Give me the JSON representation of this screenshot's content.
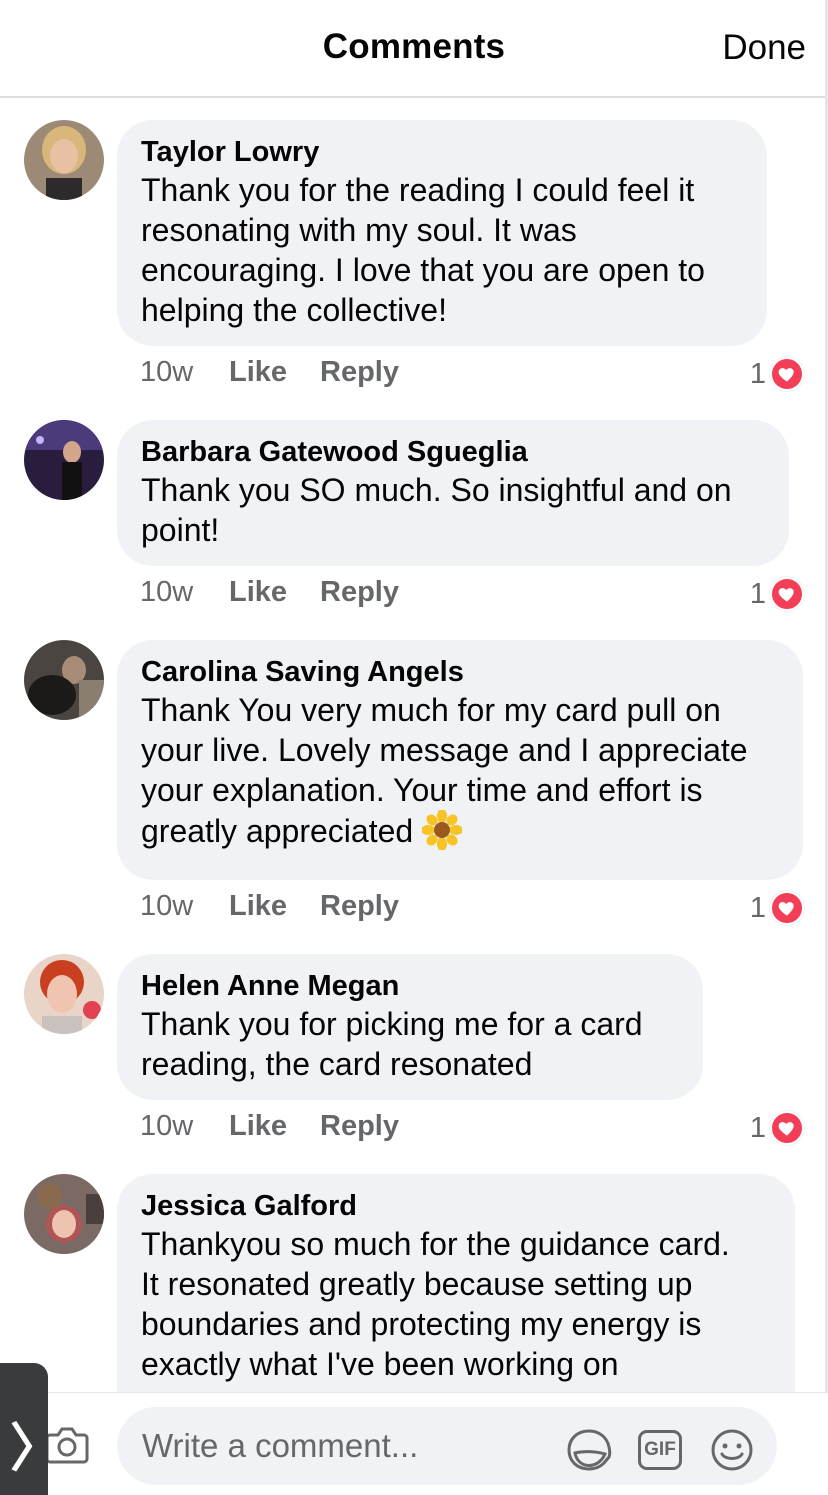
{
  "header": {
    "title": "Comments",
    "done_label": "Done"
  },
  "comments": [
    {
      "author": "Taylor Lowry",
      "text": "Thank you for the reading I could feel it\nresonating with my soul. It was\nencouraging. I love that you are open to\nhelping the collective!",
      "time": "10w",
      "like_label": "Like",
      "reply_label": "Reply",
      "reaction_count": "1",
      "reaction_icon": "heart-icon"
    },
    {
      "author": "Barbara Gatewood Sgueglia",
      "text": "Thank you SO much. So insightful and on\npoint!",
      "time": "10w",
      "like_label": "Like",
      "reply_label": "Reply",
      "reaction_count": "1",
      "reaction_icon": "heart-icon"
    },
    {
      "author": "Carolina Saving Angels",
      "text": "Thank You very much for my card pull on\nyour live. Lovely message and I appreciate\nyour explanation. Your time and effort is\ngreatly appreciated",
      "emoji": "sunflower-emoji",
      "time": "10w",
      "like_label": "Like",
      "reply_label": "Reply",
      "reaction_count": "1",
      "reaction_icon": "heart-icon"
    },
    {
      "author": "Helen Anne Megan",
      "text": "Thank you for picking me for a card\nreading, the card resonated",
      "time": "10w",
      "like_label": "Like",
      "reply_label": "Reply",
      "reaction_count": "1",
      "reaction_icon": "heart-icon"
    },
    {
      "author": "Jessica Galford",
      "text": "Thankyou so much for the guidance card.\nIt resonated greatly because setting up\nboundaries and protecting my energy is\nexactly what I've been working on"
    }
  ],
  "composer": {
    "placeholder": "Write a comment...",
    "icons": [
      "camera-icon",
      "sticker-icon",
      "gif-icon",
      "emoji-icon"
    ],
    "gif_label": "GIF"
  },
  "colors": {
    "bubble": "#f0f2f5",
    "secondary_text": "#65676b",
    "reaction_heart": "#f33e58"
  }
}
